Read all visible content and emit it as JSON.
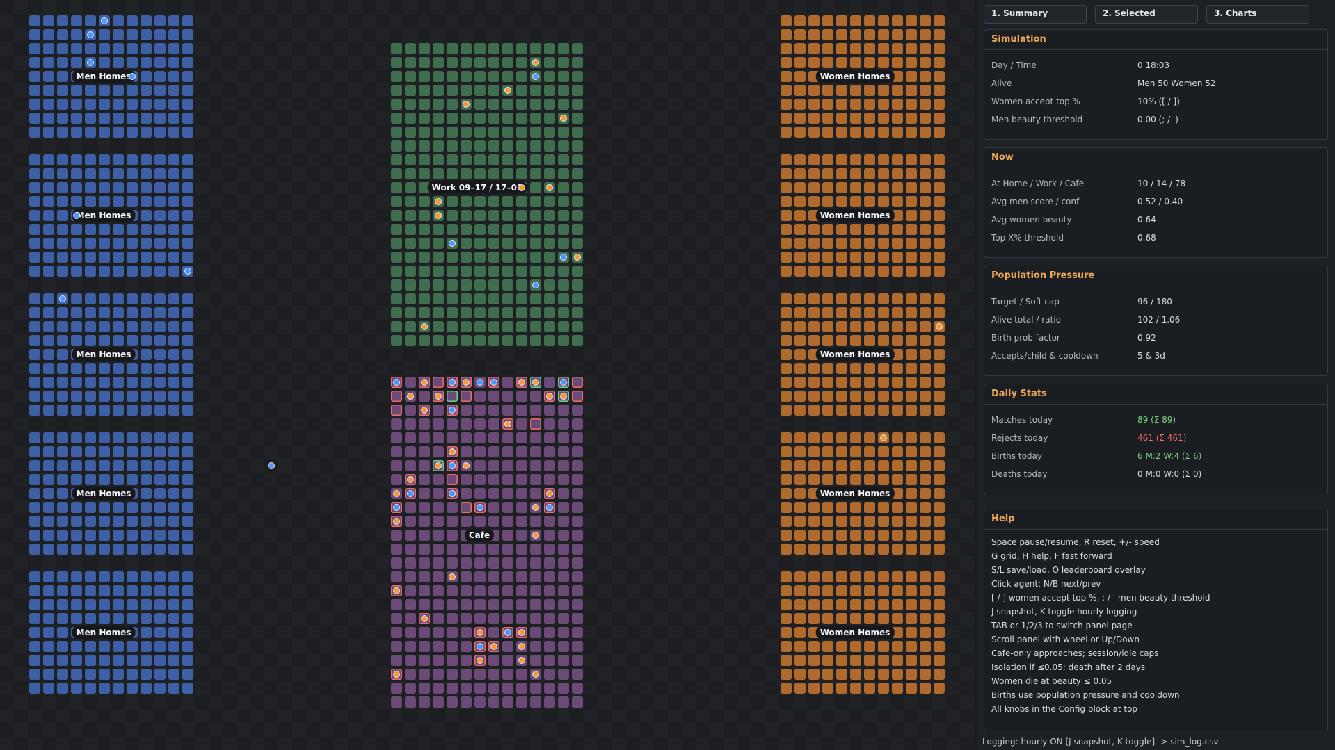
{
  "world": {
    "labels": {
      "men_homes": "Men Homes",
      "women_homes": "Women Homes",
      "work": "Work 09–17 / 17–01",
      "cafe": "Cafe"
    },
    "colors": {
      "men_tile": "#3c5fa6",
      "women_tile": "#b06a2d",
      "work_tile": "#3f6e4e",
      "cafe_tile": "#6b4a78",
      "man_agent": "#4f97ff",
      "woman_agent": "#f39a3c",
      "highlight_reject": "#f06a6a",
      "highlight_match": "#6bd18a"
    }
  },
  "panel": {
    "tabs": [
      "1. Summary",
      "2. Selected",
      "3. Charts"
    ],
    "simulation": {
      "title": "Simulation",
      "rows": [
        {
          "k": "Day / Time",
          "v": "0    18:03"
        },
        {
          "k": "Alive",
          "v": "Men 50    Women 52"
        },
        {
          "k": "Women accept top %",
          "v": "10%  ([ / ])"
        },
        {
          "k": "Men beauty threshold",
          "v": "0.00  (; / ')"
        }
      ]
    },
    "now": {
      "title": "Now",
      "rows": [
        {
          "k": "At Home / Work / Cafe",
          "v": "10 / 14 / 78"
        },
        {
          "k": "Avg men score / conf",
          "v": "0.52 / 0.40"
        },
        {
          "k": "Avg women beauty",
          "v": "0.64"
        },
        {
          "k": "Top-X% threshold",
          "v": "0.68"
        }
      ]
    },
    "pressure": {
      "title": "Population Pressure",
      "rows": [
        {
          "k": "Target / Soft cap",
          "v": "96 / 180"
        },
        {
          "k": "Alive total / ratio",
          "v": "102 / 1.06"
        },
        {
          "k": "Birth prob factor",
          "v": "0.92"
        },
        {
          "k": "Accepts/child & cooldown",
          "v": "5 & 3d"
        }
      ]
    },
    "daily": {
      "title": "Daily Stats",
      "rows": [
        {
          "k": "Matches today",
          "v": "89 (Σ 89)",
          "tone": "green"
        },
        {
          "k": "Rejects today",
          "v": "461 (Σ 461)",
          "tone": "red"
        },
        {
          "k": "Births today",
          "v": "6  M:2  W:4  (Σ 6)",
          "tone": "green"
        },
        {
          "k": "Deaths today",
          "v": "0  M:0  W:0  (Σ 0)",
          "tone": ""
        }
      ]
    },
    "help": {
      "title": "Help",
      "lines": [
        "Space pause/resume, R reset, +/- speed",
        "G grid, H help, F fast forward",
        "S/L save/load, O leaderboard overlay",
        "Click agent; N/B next/prev",
        "[ / ] women accept top %,  ; / ' men beauty threshold",
        "J snapshot, K toggle hourly logging",
        "TAB or 1/2/3 to switch panel page",
        "Scroll panel with wheel or Up/Down",
        "Cafe-only approaches; session/idle caps",
        "Isolation if ≤0.05; death after 2 days",
        "Women die at beauty ≤ 0.05",
        "Births use population pressure and cooldown",
        "All knobs in the Config block at top"
      ]
    }
  },
  "status": {
    "logging": "Logging: hourly ON  [J snapshot, K toggle] -> sim_log.csv"
  }
}
